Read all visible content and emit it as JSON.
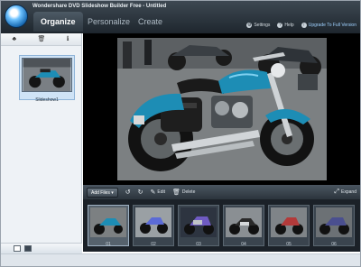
{
  "window": {
    "title": "Wondershare DVD Slideshow Builder Free - Untitled"
  },
  "nav": {
    "tabs": [
      {
        "label": "Organize",
        "active": true
      },
      {
        "label": "Personalize",
        "active": false
      },
      {
        "label": "Create",
        "active": false
      }
    ]
  },
  "top_links": {
    "settings": "Settings",
    "help": "Help",
    "upgrade": "Upgrade To Full Version"
  },
  "sidebar": {
    "thumbnail_label": "Slideshow1"
  },
  "action_bar": {
    "add_button": "Add Files",
    "edit": "Edit",
    "delete": "Delete",
    "expand": "Expand"
  },
  "filmstrip": {
    "frames": [
      {
        "num": "01",
        "selected": true
      },
      {
        "num": "02",
        "selected": false
      },
      {
        "num": "03",
        "selected": false
      },
      {
        "num": "04",
        "selected": false
      },
      {
        "num": "05",
        "selected": false
      },
      {
        "num": "06",
        "selected": false
      }
    ]
  },
  "colors": {
    "accent": "#1d6fb8",
    "bike_blue": "#1d8db5",
    "dark_bar": "#2b343c"
  }
}
